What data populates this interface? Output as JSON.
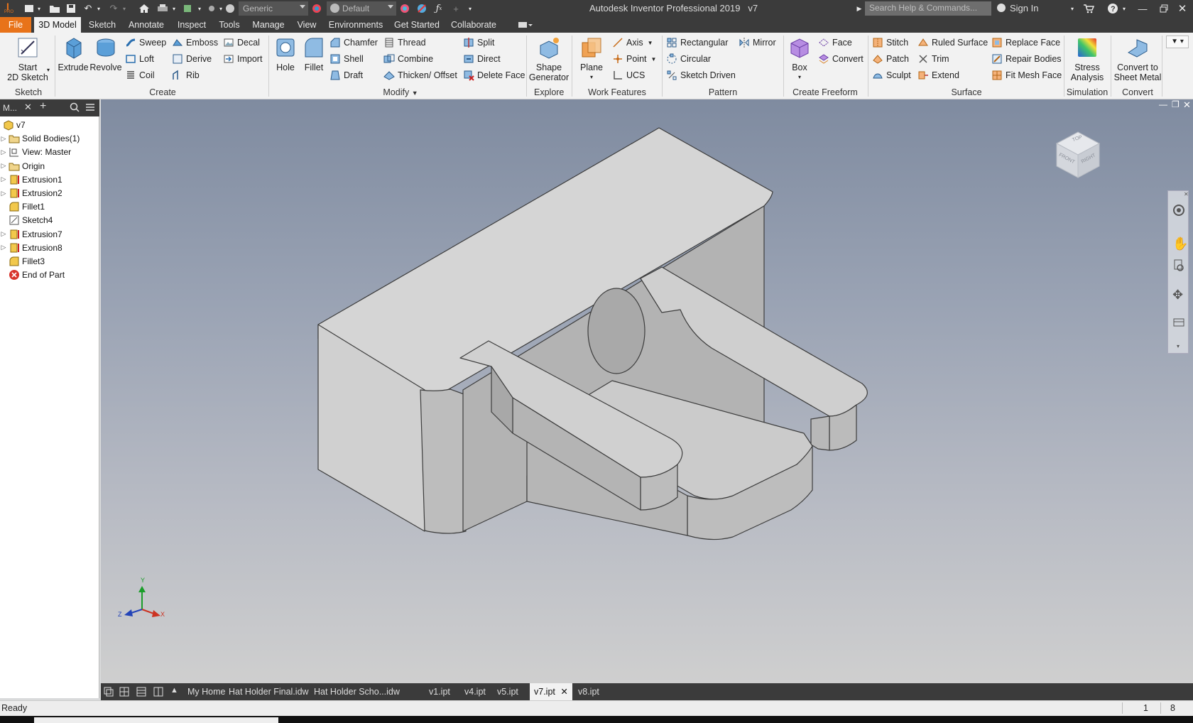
{
  "app": {
    "title": "Autodesk Inventor Professional 2019",
    "document": "v7",
    "logo_text": "I",
    "edition_text": "PRO"
  },
  "quick_access": {
    "material": "Generic",
    "appearance": "Default",
    "search_placeholder": "Search Help & Commands...",
    "sign_in": "Sign In"
  },
  "menu": {
    "file": "File",
    "tabs": [
      "3D Model",
      "Sketch",
      "Annotate",
      "Inspect",
      "Tools",
      "Manage",
      "View",
      "Environments",
      "Get Started",
      "Collaborate"
    ],
    "active": "3D Model"
  },
  "ribbon": {
    "sketch": {
      "group": "Sketch",
      "start_line1": "Start",
      "start_line2": "2D Sketch"
    },
    "create": {
      "group": "Create",
      "extrude": "Extrude",
      "revolve": "Revolve",
      "sweep": "Sweep",
      "loft": "Loft",
      "coil": "Coil",
      "emboss": "Emboss",
      "derive": "Derive",
      "rib": "Rib",
      "decal": "Decal",
      "import": "Import"
    },
    "modify": {
      "group": "Modify",
      "hole": "Hole",
      "fillet": "Fillet",
      "chamfer": "Chamfer",
      "shell": "Shell",
      "draft": "Draft",
      "thread": "Thread",
      "combine": "Combine",
      "thicken": "Thicken/ Offset",
      "split": "Split",
      "direct": "Direct",
      "delete_face": "Delete Face"
    },
    "explore": {
      "group": "Explore",
      "shape_gen_line1": "Shape",
      "shape_gen_line2": "Generator"
    },
    "work_features": {
      "group": "Work Features",
      "plane": "Plane",
      "axis": "Axis",
      "point": "Point",
      "ucs": "UCS"
    },
    "pattern": {
      "group": "Pattern",
      "rectangular": "Rectangular",
      "circular": "Circular",
      "sketch_driven": "Sketch Driven",
      "mirror": "Mirror"
    },
    "freeform": {
      "group": "Create Freeform",
      "box": "Box",
      "face": "Face",
      "convert": "Convert"
    },
    "surface": {
      "group": "Surface",
      "stitch": "Stitch",
      "patch": "Patch",
      "sculpt": "Sculpt",
      "ruled_surface": "Ruled Surface",
      "trim": "Trim",
      "extend": "Extend",
      "replace_face": "Replace Face",
      "repair_bodies": "Repair Bodies",
      "fit_mesh_face": "Fit Mesh Face"
    },
    "simulation": {
      "group": "Simulation",
      "stress_line1": "Stress",
      "stress_line2": "Analysis"
    },
    "convert": {
      "group": "Convert",
      "sheet_line1": "Convert to",
      "sheet_line2": "Sheet Metal"
    }
  },
  "browser": {
    "title": "M...",
    "items": [
      {
        "label": "v7",
        "icon": "part-icon",
        "expandable": false
      },
      {
        "label": "Solid Bodies(1)",
        "icon": "folder-icon",
        "expandable": true
      },
      {
        "label": "View: Master",
        "icon": "view-icon",
        "expandable": true
      },
      {
        "label": "Origin",
        "icon": "folder-icon",
        "expandable": true
      },
      {
        "label": "Extrusion1",
        "icon": "extrusion-icon",
        "expandable": true
      },
      {
        "label": "Extrusion2",
        "icon": "extrusion-icon",
        "expandable": true
      },
      {
        "label": "Fillet1",
        "icon": "fillet-icon",
        "expandable": false
      },
      {
        "label": "Sketch4",
        "icon": "sketch-icon",
        "expandable": false
      },
      {
        "label": "Extrusion7",
        "icon": "extrusion-icon",
        "expandable": true
      },
      {
        "label": "Extrusion8",
        "icon": "extrusion-icon",
        "expandable": true
      },
      {
        "label": "Fillet3",
        "icon": "fillet-icon",
        "expandable": false
      },
      {
        "label": "End of Part",
        "icon": "end-of-part-icon",
        "expandable": false
      }
    ]
  },
  "viewcube": {
    "top": "TOP",
    "front": "FRONT",
    "right": "RIGHT"
  },
  "triad": {
    "x": "X",
    "y": "Y",
    "z": "Z"
  },
  "document_tabs": [
    "My Home",
    "Hat Holder Final.idw",
    "Hat Holder Scho...idw",
    "v1.ipt",
    "v4.ipt",
    "v5.ipt",
    "v7.ipt",
    "v8.ipt"
  ],
  "active_document": "v7.ipt",
  "status": {
    "text": "Ready",
    "count1": "1",
    "count2": "8"
  },
  "colors": {
    "accent": "#e8731a",
    "chrome": "#3b3b3b",
    "ribbon": "#f2f2f2",
    "model": "#c9c9c9"
  }
}
